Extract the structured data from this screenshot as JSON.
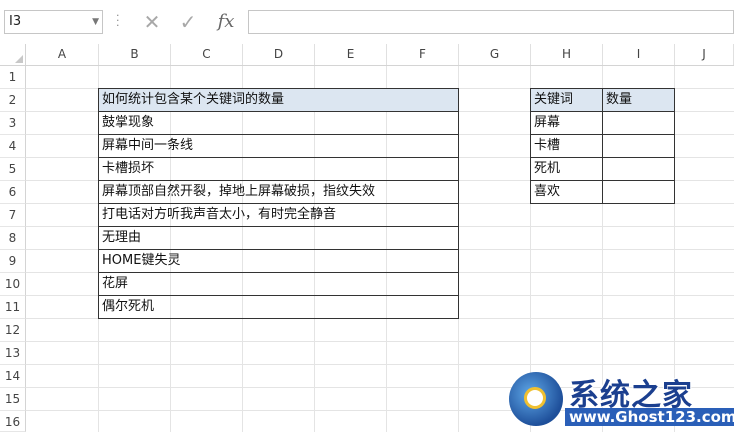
{
  "name_box": "I3",
  "formula_bar": {
    "cancel_icon": "✕",
    "enter_icon": "✓",
    "fx_label": "fx",
    "content": ""
  },
  "columns": [
    "A",
    "B",
    "C",
    "D",
    "E",
    "F",
    "G",
    "H",
    "I",
    "J"
  ],
  "rows": [
    "1",
    "2",
    "3",
    "4",
    "5",
    "6",
    "7",
    "8",
    "9",
    "10",
    "11",
    "12",
    "13",
    "14",
    "15",
    "16"
  ],
  "table_left": {
    "header": "如何统计包含某个关键词的数量",
    "items": [
      "鼓掌现象",
      "屏幕中间一条线",
      "卡槽损坏",
      "屏幕顶部自然开裂，掉地上屏幕破损，指纹失效",
      "打电话对方听我声音太小，有时完全静音",
      "无理由",
      "HOME键失灵",
      "花屏",
      "偶尔死机"
    ]
  },
  "table_right": {
    "headers": [
      "关键词",
      "数量"
    ],
    "keywords": [
      "屏幕",
      "卡槽",
      "死机",
      "喜欢"
    ],
    "counts": [
      "",
      "",
      "",
      ""
    ]
  },
  "watermark": {
    "title": "系统之家",
    "url": "www.Ghost123.com"
  },
  "colors": {
    "header_fill": "#dce6f1",
    "border": "#333333",
    "gridline": "#e4e4e4"
  }
}
